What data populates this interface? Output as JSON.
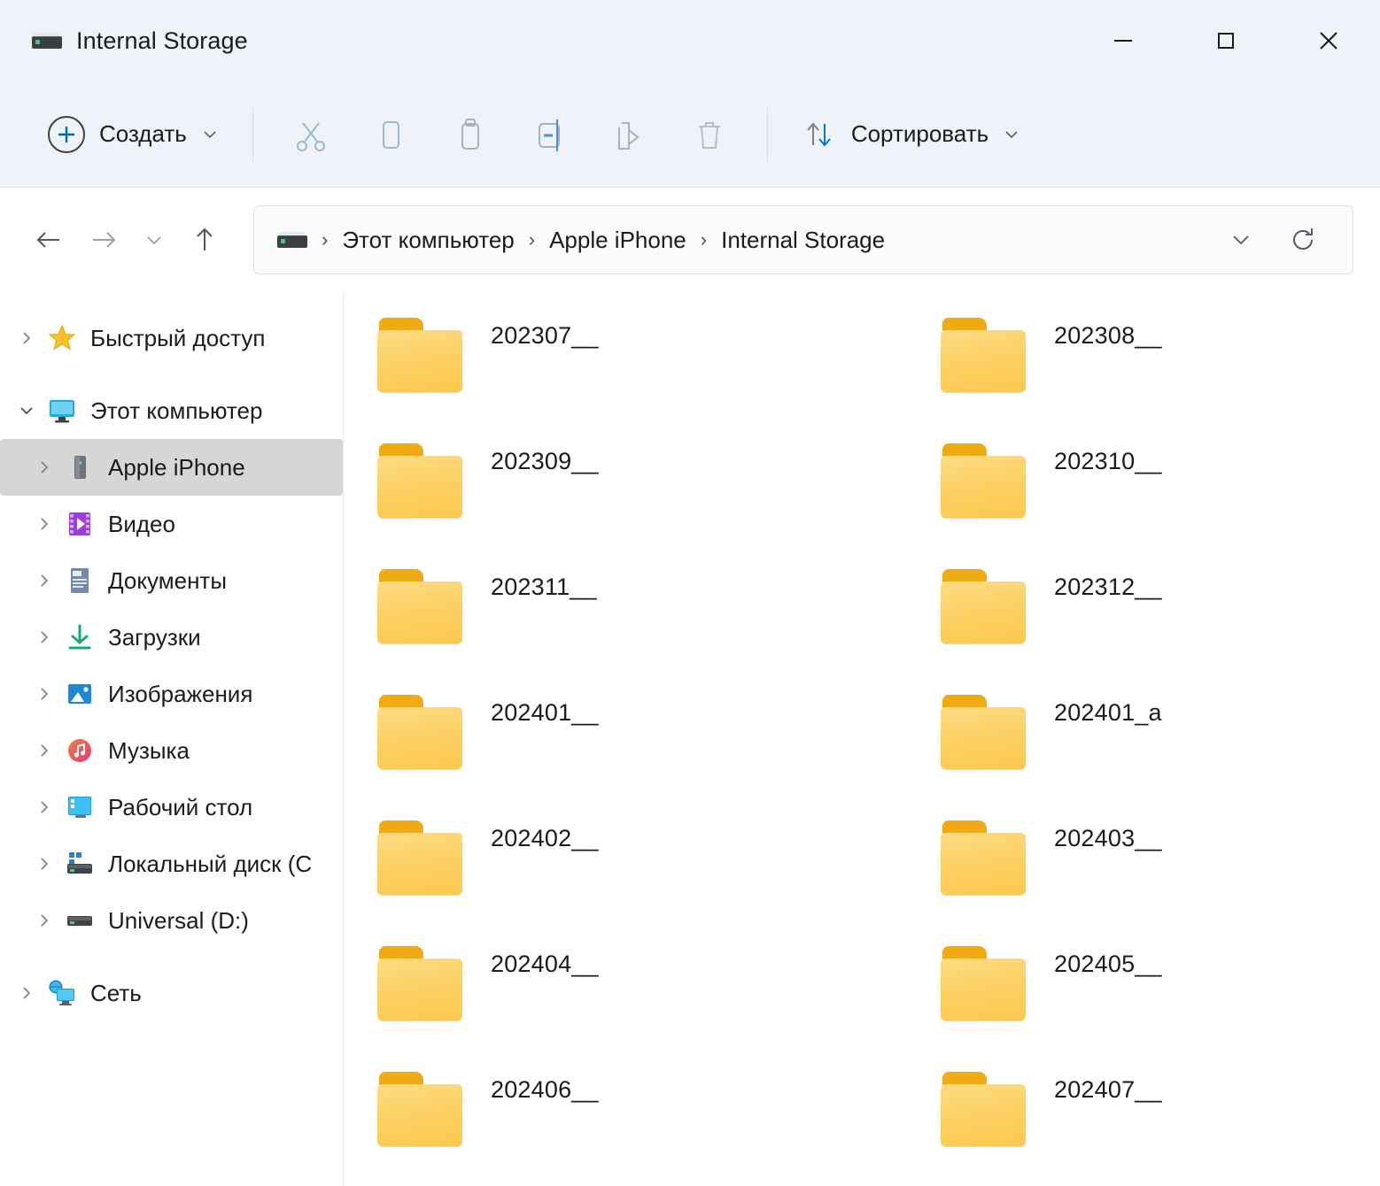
{
  "window": {
    "title": "Internal Storage",
    "title_icon": "drive-icon",
    "controls": {
      "minimize": "minimize-icon",
      "maximize": "maximize-icon",
      "close": "close-icon"
    }
  },
  "toolbar": {
    "new_label": "Создать",
    "new_icon": "plus-circle-icon",
    "new_dropdown_icon": "chevron-down-icon",
    "actions": [
      {
        "name": "cut",
        "icon": "scissors-icon"
      },
      {
        "name": "copy",
        "icon": "copy-icon"
      },
      {
        "name": "paste",
        "icon": "clipboard-paste-icon"
      },
      {
        "name": "rename",
        "icon": "rename-icon"
      },
      {
        "name": "share",
        "icon": "share-icon"
      },
      {
        "name": "delete",
        "icon": "trash-icon"
      }
    ],
    "sort_label": "Сортировать",
    "sort_icon": "sort-arrows-icon",
    "sort_dropdown_icon": "chevron-down-icon"
  },
  "navbar": {
    "back_icon": "arrow-left-icon",
    "forward_icon": "arrow-right-icon",
    "recent_icon": "chevron-down-icon",
    "up_icon": "arrow-up-icon",
    "address": {
      "leading_icon": "drive-icon",
      "crumbs": [
        "Этот компьютер",
        "Apple iPhone",
        "Internal Storage"
      ],
      "separator": "›",
      "history_icon": "chevron-down-icon",
      "refresh_icon": "refresh-icon"
    }
  },
  "sidebar": {
    "items": [
      {
        "label": "Быстрый доступ",
        "icon": "star-icon",
        "level": 0,
        "expanded": false,
        "selected": false
      },
      {
        "label": "Этот компьютер",
        "icon": "monitor-icon",
        "level": 0,
        "expanded": true,
        "selected": false
      },
      {
        "label": "Apple iPhone",
        "icon": "phone-icon",
        "level": 1,
        "expanded": false,
        "selected": true
      },
      {
        "label": "Видео",
        "icon": "video-icon",
        "level": 1,
        "expanded": false,
        "selected": false
      },
      {
        "label": "Документы",
        "icon": "document-icon",
        "level": 1,
        "expanded": false,
        "selected": false
      },
      {
        "label": "Загрузки",
        "icon": "download-icon",
        "level": 1,
        "expanded": false,
        "selected": false
      },
      {
        "label": "Изображения",
        "icon": "pictures-icon",
        "level": 1,
        "expanded": false,
        "selected": false
      },
      {
        "label": "Музыка",
        "icon": "music-icon",
        "level": 1,
        "expanded": false,
        "selected": false
      },
      {
        "label": "Рабочий стол",
        "icon": "desktop-icon",
        "level": 1,
        "expanded": false,
        "selected": false
      },
      {
        "label": "Локальный диск (C",
        "icon": "local-disk-icon",
        "level": 1,
        "expanded": false,
        "selected": false
      },
      {
        "label": "Universal (D:)",
        "icon": "drive-icon",
        "level": 1,
        "expanded": false,
        "selected": false
      },
      {
        "label": "Сеть",
        "icon": "network-icon",
        "level": 0,
        "expanded": false,
        "selected": false
      }
    ]
  },
  "files": {
    "view": "medium-icons",
    "items": [
      {
        "name": "202307__",
        "icon": "folder-icon"
      },
      {
        "name": "202308__",
        "icon": "folder-icon"
      },
      {
        "name": "202309__",
        "icon": "folder-icon"
      },
      {
        "name": "202310__",
        "icon": "folder-icon"
      },
      {
        "name": "202311__",
        "icon": "folder-icon"
      },
      {
        "name": "202312__",
        "icon": "folder-icon"
      },
      {
        "name": "202401__",
        "icon": "folder-icon"
      },
      {
        "name": "202401_a",
        "icon": "folder-icon"
      },
      {
        "name": "202402__",
        "icon": "folder-icon"
      },
      {
        "name": "202403__",
        "icon": "folder-icon"
      },
      {
        "name": "202404__",
        "icon": "folder-icon"
      },
      {
        "name": "202405__",
        "icon": "folder-icon"
      },
      {
        "name": "202406__",
        "icon": "folder-icon"
      },
      {
        "name": "202407__",
        "icon": "folder-icon"
      }
    ]
  },
  "colors": {
    "chrome": "#eff3f9",
    "accent": "#0067c0",
    "folder_tab": "#f0ab14",
    "folder_body": "#fcd167",
    "selection": "#d6d6d6",
    "text": "#1b1b1b"
  }
}
